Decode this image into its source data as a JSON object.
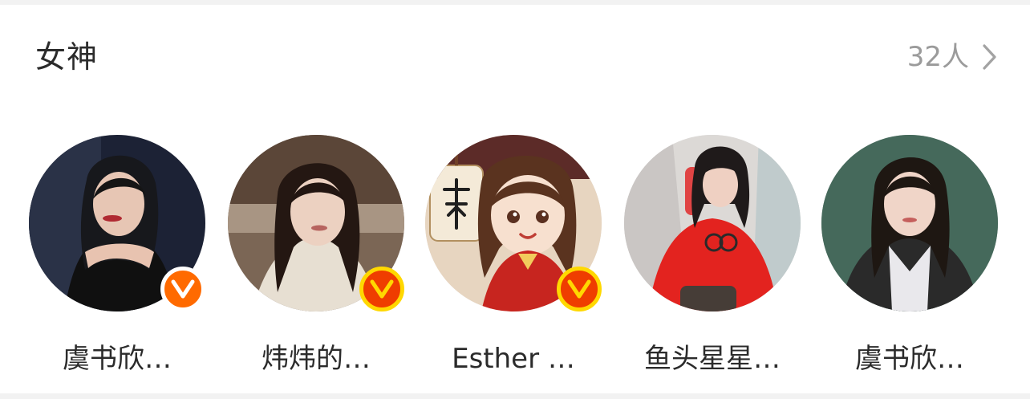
{
  "section": {
    "title": "女神",
    "more_count": "32人",
    "more_icon": "chevron-right-icon"
  },
  "colors": {
    "title_text": "#2b2b2b",
    "secondary_text": "#9b9b9b",
    "verify_orange": "#ff6a00",
    "verify_red": "#ef3d00",
    "verify_gold": "#ffd800"
  },
  "friends": [
    {
      "name": "虞书欣…",
      "avatar_icon": "avatar-photo",
      "badge": "verified-v-badge"
    },
    {
      "name": "炜炜的…",
      "avatar_icon": "avatar-photo",
      "badge": "verified-v-badge"
    },
    {
      "name": "Esther …",
      "avatar_icon": "avatar-illustration",
      "badge": "verified-v-badge"
    },
    {
      "name": "鱼头星星…",
      "avatar_icon": "avatar-photo",
      "badge": ""
    },
    {
      "name": "虞书欣…",
      "avatar_icon": "avatar-photo",
      "badge": ""
    }
  ]
}
